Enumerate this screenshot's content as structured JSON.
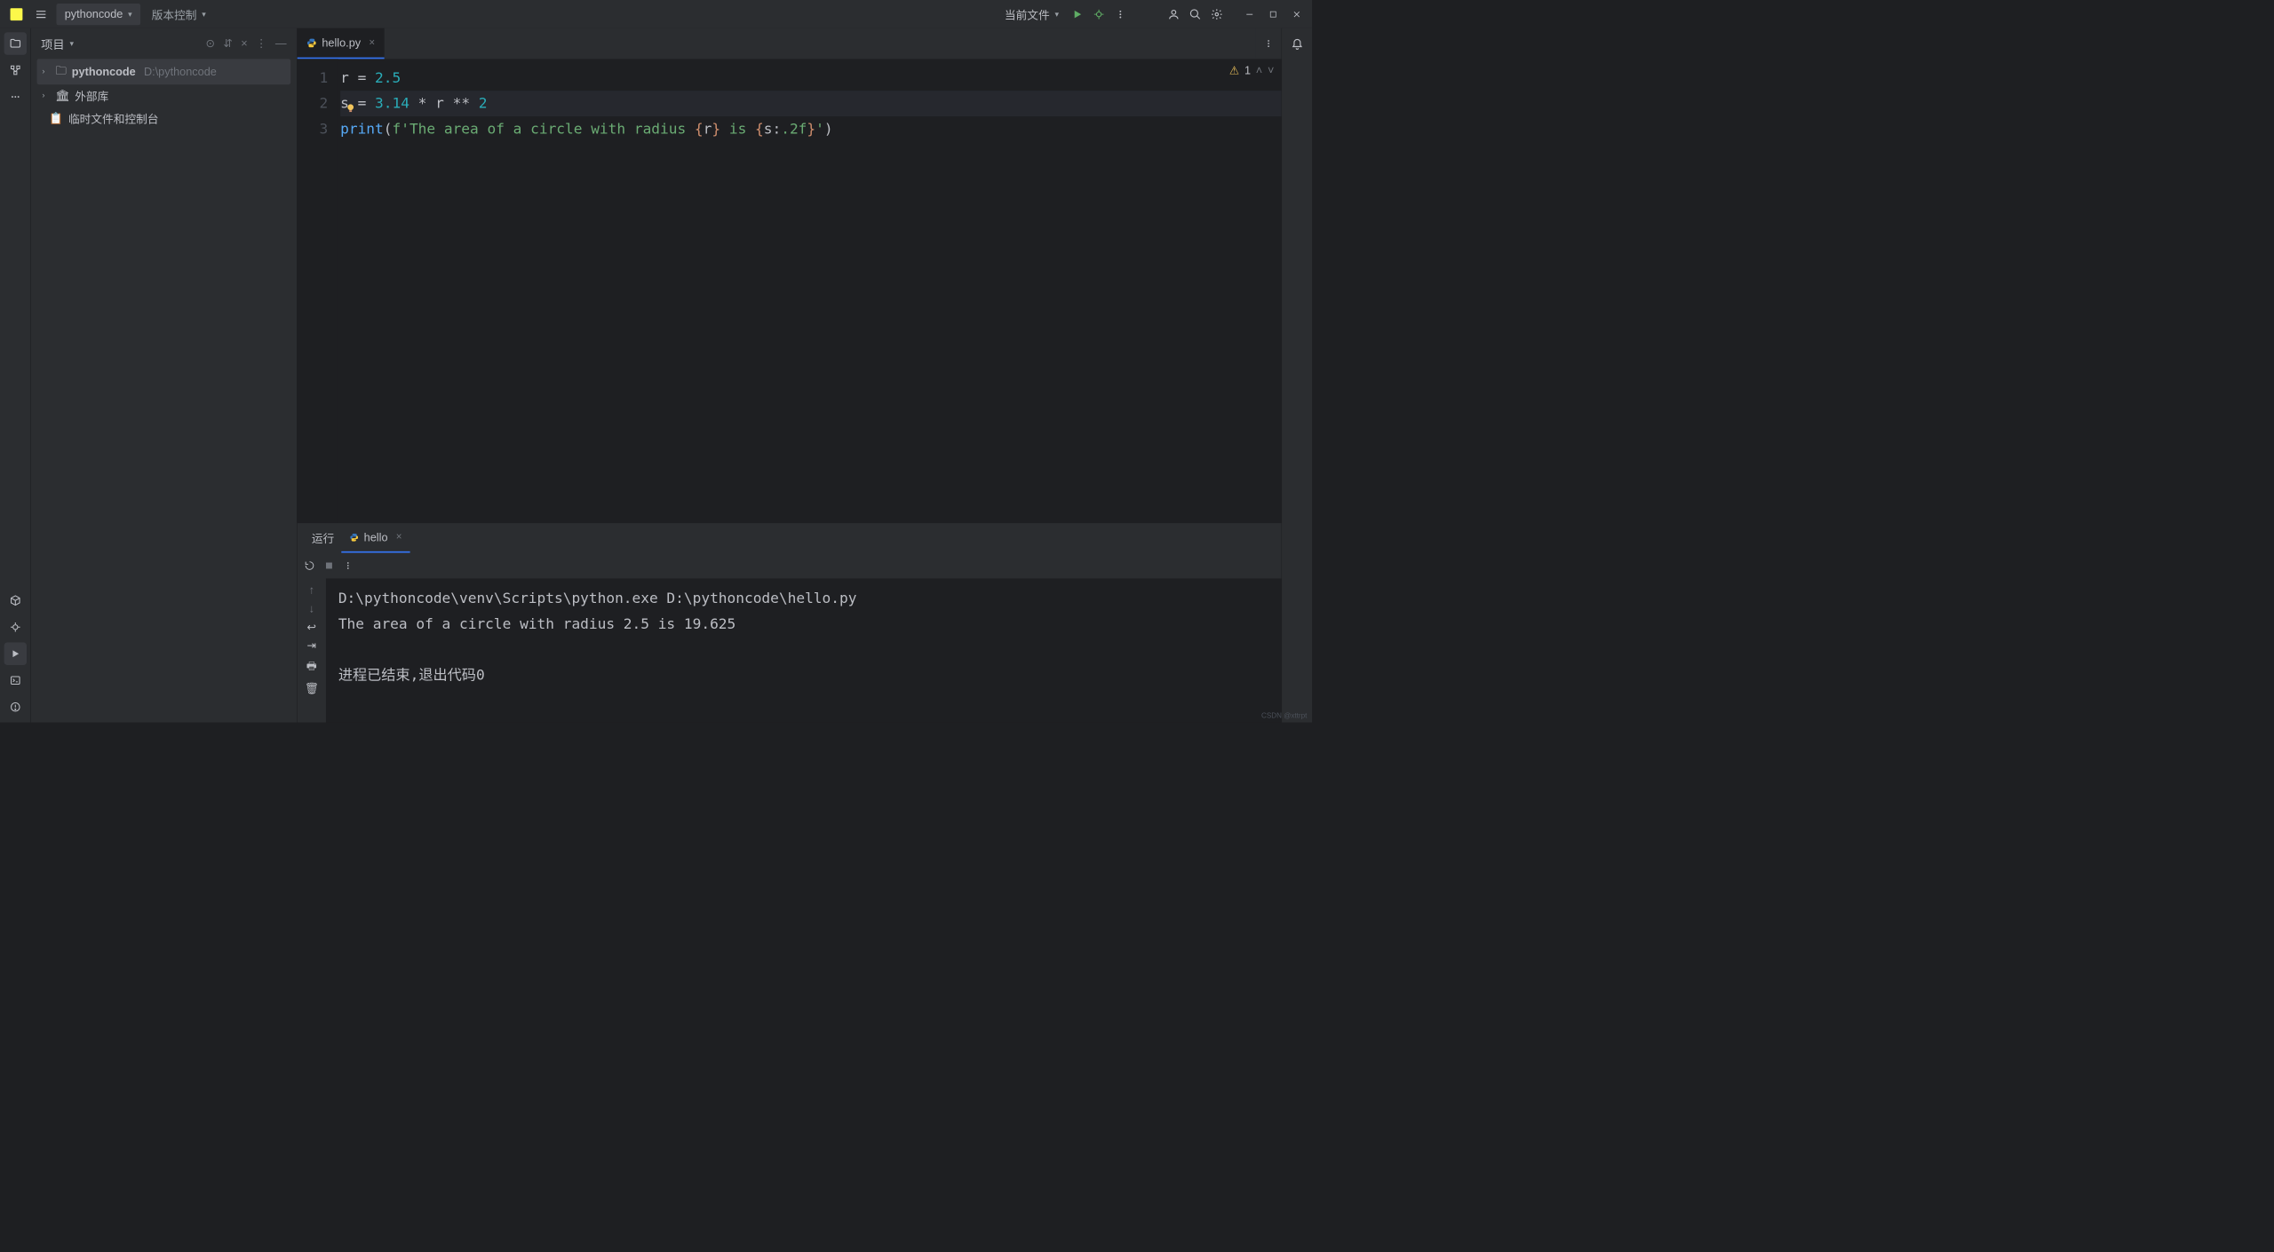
{
  "titlebar": {
    "project_name": "pythoncode",
    "vcs_label": "版本控制",
    "runconfig_label": "当前文件"
  },
  "project_panel": {
    "title": "项目",
    "root_name": "pythoncode",
    "root_path": "D:\\pythoncode",
    "external_libs": "外部库",
    "scratches": "临时文件和控制台"
  },
  "editor": {
    "tab_name": "hello.py",
    "inspections_count": "1",
    "lines": [
      {
        "n": "1",
        "tokens": [
          [
            "var",
            "r"
          ],
          [
            "op",
            " = "
          ],
          [
            "num",
            "2.5"
          ]
        ]
      },
      {
        "n": "2",
        "tokens": [
          [
            "var",
            "s"
          ],
          [
            "op",
            " = "
          ],
          [
            "num",
            "3.14"
          ],
          [
            "op",
            " * "
          ],
          [
            "var",
            "r"
          ],
          [
            "op",
            " ** "
          ],
          [
            "num",
            "2"
          ]
        ]
      },
      {
        "n": "3",
        "tokens": [
          [
            "fn",
            "print"
          ],
          [
            "op",
            "("
          ],
          [
            "str",
            "f'The area of a circle with radius "
          ],
          [
            "brace",
            "{"
          ],
          [
            "var",
            "r"
          ],
          [
            "brace",
            "}"
          ],
          [
            "str",
            " is "
          ],
          [
            "brace",
            "{"
          ],
          [
            "var",
            "s"
          ],
          [
            "op",
            ":"
          ],
          [
            "str",
            ".2f"
          ],
          [
            "brace",
            "}"
          ],
          [
            "str",
            "'"
          ],
          [
            "op",
            ")"
          ]
        ]
      }
    ]
  },
  "run_panel": {
    "run_label": "运行",
    "tab_name": "hello",
    "console_lines": [
      "D:\\pythoncode\\venv\\Scripts\\python.exe D:\\pythoncode\\hello.py",
      "The area of a circle with radius 2.5 is 19.625",
      "",
      "进程已结束,退出代码0"
    ]
  },
  "watermark": "CSDN @xttrpt"
}
